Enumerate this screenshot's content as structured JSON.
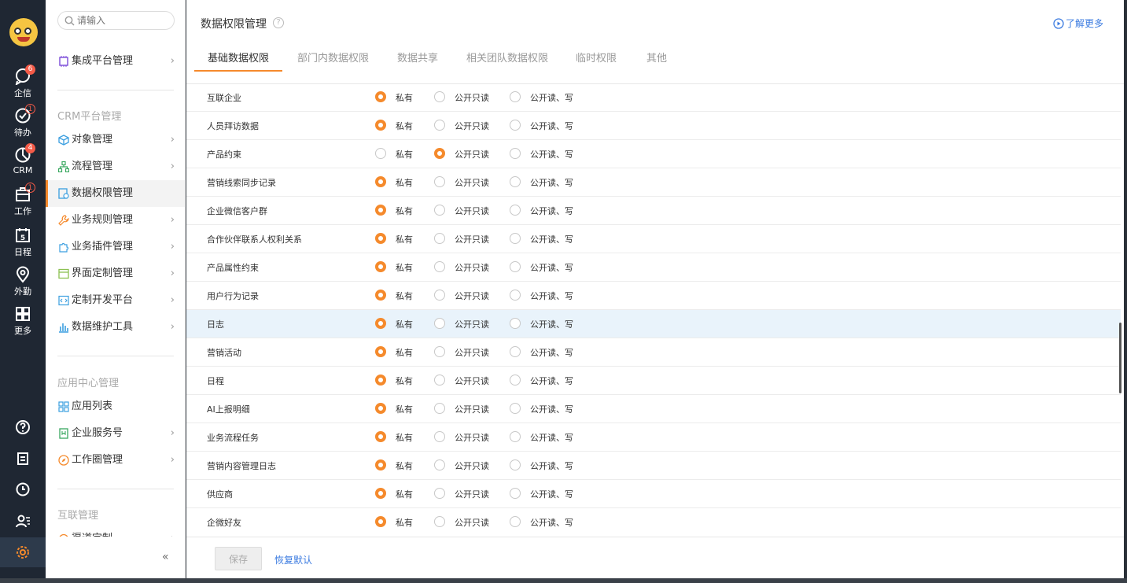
{
  "rail": {
    "items": [
      {
        "label": "企信",
        "badge": "6"
      },
      {
        "label": "待办",
        "badge": "1"
      },
      {
        "label": "CRM",
        "badge": "4"
      },
      {
        "label": "工作",
        "badge": "1"
      },
      {
        "label": "日程",
        "badge": "",
        "day": "5"
      },
      {
        "label": "外勤",
        "badge": ""
      },
      {
        "label": "更多",
        "badge": ""
      }
    ]
  },
  "subnav": {
    "search_placeholder": "请输入",
    "top_item": "集成平台管理",
    "section_crm": "CRM平台管理",
    "crm_items": [
      "对象管理",
      "流程管理",
      "数据权限管理",
      "业务规则管理",
      "业务插件管理",
      "界面定制管理",
      "定制开发平台",
      "数据维护工具"
    ],
    "section_app": "应用中心管理",
    "app_items": [
      "应用列表",
      "企业服务号",
      "工作圈管理"
    ],
    "section_interconnect": "互联管理",
    "interconnect_items": [
      "渠道定制"
    ],
    "collapse_glyph": "«"
  },
  "main": {
    "title": "数据权限管理",
    "help_glyph": "?",
    "more_link": "了解更多",
    "tabs": [
      "基础数据权限",
      "部门内数据权限",
      "数据共享",
      "相关团队数据权限",
      "临时权限",
      "其他"
    ],
    "option_labels": [
      "私有",
      "公开只读",
      "公开读、写"
    ],
    "rows": [
      {
        "name": "互联企业",
        "selected": 0
      },
      {
        "name": "人员拜访数据",
        "selected": 0
      },
      {
        "name": "产品约束",
        "selected": 1
      },
      {
        "name": "营销线索同步记录",
        "selected": 0
      },
      {
        "name": "企业微信客户群",
        "selected": 0
      },
      {
        "name": "合作伙伴联系人权利关系",
        "selected": 0
      },
      {
        "name": "产品属性约束",
        "selected": 0
      },
      {
        "name": "用户行为记录",
        "selected": 0
      },
      {
        "name": "日志",
        "selected": 0,
        "highlight": true
      },
      {
        "name": "营销活动",
        "selected": 0
      },
      {
        "name": "日程",
        "selected": 0
      },
      {
        "name": "AI上报明细",
        "selected": 0
      },
      {
        "name": "业务流程任务",
        "selected": 0
      },
      {
        "name": "营销内容管理日志",
        "selected": 0
      },
      {
        "name": "供应商",
        "selected": 0
      },
      {
        "name": "企微好友",
        "selected": 0
      }
    ],
    "save_label": "保存",
    "reset_label": "恢复默认"
  },
  "colors": {
    "accent": "#f58a2c",
    "link": "#3b7be0",
    "rail": "#1f2733"
  }
}
